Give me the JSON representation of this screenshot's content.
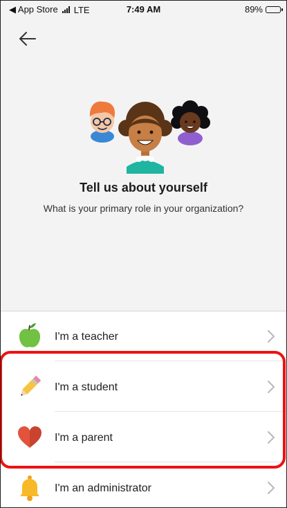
{
  "status_bar": {
    "carrier": "◀ App Store",
    "network": "LTE",
    "time": "7:49 AM",
    "battery": "89%",
    "battery_level": 0.89
  },
  "nav": {
    "back_icon": "arrow-left-icon"
  },
  "header": {
    "title": "Tell us about yourself",
    "subtitle": "What is your primary role in your organization?"
  },
  "roles": [
    {
      "label": "I'm a teacher",
      "icon": "apple-icon"
    },
    {
      "label": "I'm a student",
      "icon": "pencil-icon"
    },
    {
      "label": "I'm a parent",
      "icon": "heart-icon"
    },
    {
      "label": "I'm an administrator",
      "icon": "bell-icon"
    }
  ],
  "colors": {
    "background": "#f3f3f4",
    "list_background": "#ffffff",
    "annotation": "#ee1111",
    "chevron": "#b8b8bd"
  }
}
